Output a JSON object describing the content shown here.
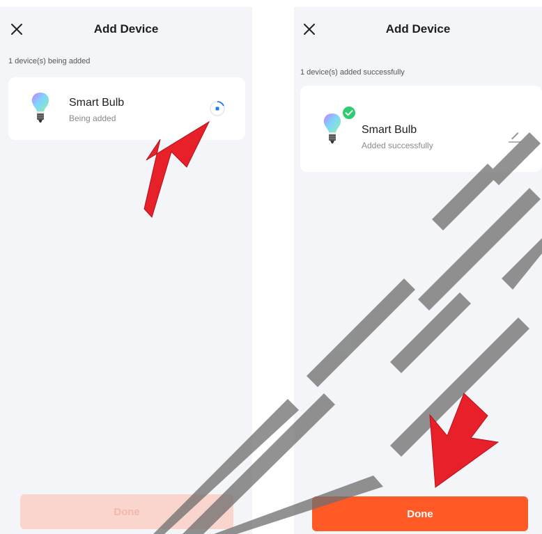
{
  "colors": {
    "accent": "#ff5a26",
    "accent_disabled": "#f9d5cd",
    "arrow": "#e8202a",
    "success": "#2ecc71",
    "spinner": "#1f7be8",
    "watermark": "#6e6e6e"
  },
  "left_screen": {
    "title": "Add Device",
    "status": "1 device(s) being added",
    "device": {
      "name": "Smart Bulb",
      "status": "Being added"
    },
    "done_label": "Done"
  },
  "right_screen": {
    "title": "Add Device",
    "status": "1 device(s) added successfully",
    "device": {
      "name": "Smart Bulb",
      "status": "Added successfully"
    },
    "done_label": "Done"
  },
  "icons": {
    "close": "close-icon",
    "bulb": "smart-bulb-icon",
    "loading": "loading-spinner-icon",
    "success": "check-badge-icon",
    "edit": "pencil-icon"
  }
}
